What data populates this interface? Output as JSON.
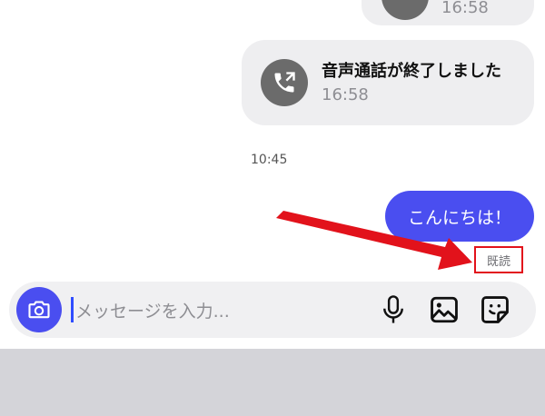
{
  "chat": {
    "partial_call_time": "16:58",
    "call": {
      "title": "音声通話が終了しました",
      "time": "16:58"
    },
    "date_stamp": "10:45",
    "message": {
      "text": "こんにちは！"
    },
    "read_receipt": "既読"
  },
  "input_bar": {
    "placeholder": "メッセージを入力..."
  },
  "icons": {
    "camera": "camera-icon",
    "call": "phone-outgoing-icon",
    "mic": "microphone-icon",
    "image": "image-icon",
    "sticker": "sticker-icon"
  },
  "colors": {
    "accent": "#4a4ef0",
    "bubble_gray": "#eeeef0",
    "annotation_red": "#e2121b",
    "bottom_panel": "#d4d4d9"
  }
}
